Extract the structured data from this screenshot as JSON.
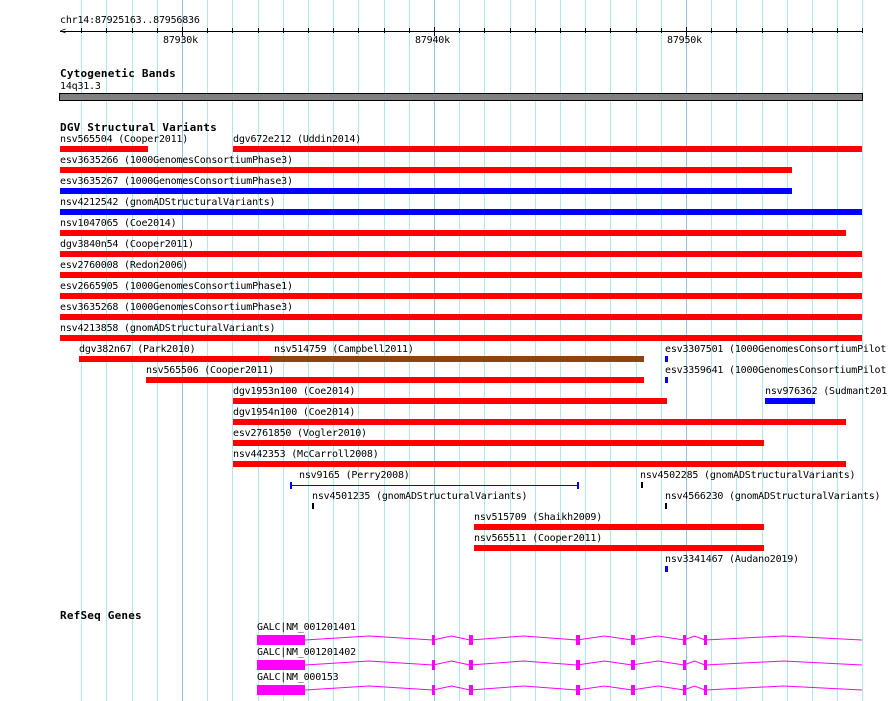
{
  "ruler": {
    "location": "chr14:87925163..87956836",
    "ticks": [
      "87930k",
      "87940k",
      "87950k"
    ]
  },
  "cytobands": {
    "title": "Cytogenetic Bands",
    "band": "14q31.3",
    "color": "#808080"
  },
  "dgv": {
    "title": "DGV Structural Variants",
    "colors": {
      "loss": "#ff0000",
      "gain": "#0000ff",
      "gain_loss": "#8b4513",
      "point": "#000000"
    },
    "features": [
      {
        "label": "nsv565504 (Cooper2011)",
        "type": "loss"
      },
      {
        "label": "dgv672e212 (Uddin2014)",
        "type": "loss"
      },
      {
        "label": "esv3635266 (1000GenomesConsortiumPhase3)",
        "type": "loss"
      },
      {
        "label": "esv3635267 (1000GenomesConsortiumPhase3)",
        "type": "gain"
      },
      {
        "label": "nsv4212542 (gnomADStructuralVariants)",
        "type": "gain"
      },
      {
        "label": "nsv1047065 (Coe2014)",
        "type": "loss"
      },
      {
        "label": "dgv3840n54 (Cooper2011)",
        "type": "loss"
      },
      {
        "label": "esv2760008 (Redon2006)",
        "type": "loss"
      },
      {
        "label": "esv2665905 (1000GenomesConsortiumPhase1)",
        "type": "loss"
      },
      {
        "label": "esv3635268 (1000GenomesConsortiumPhase3)",
        "type": "loss"
      },
      {
        "label": "nsv4213858 (gnomADStructuralVariants)",
        "type": "loss"
      },
      {
        "label": "dgv382n67 (Park2010)",
        "type": "loss"
      },
      {
        "label": "nsv514759 (Campbell2011)",
        "type": "gain_loss"
      },
      {
        "label": "esv3307501 (1000GenomesConsortiumPilot",
        "type": "gain"
      },
      {
        "label": "nsv565506 (Cooper2011)",
        "type": "loss"
      },
      {
        "label": "esv3359641 (1000GenomesConsortiumPilot",
        "type": "gain"
      },
      {
        "label": "dgv1953n100 (Coe2014)",
        "type": "loss"
      },
      {
        "label": "nsv976362 (Sudmant201",
        "type": "gain"
      },
      {
        "label": "dgv1954n100 (Coe2014)",
        "type": "loss"
      },
      {
        "label": "esv2761850 (Vogler2010)",
        "type": "loss"
      },
      {
        "label": "nsv442353 (McCarroll2008)",
        "type": "loss"
      },
      {
        "label": "nsv9165 (Perry2008)",
        "type": "gain_line"
      },
      {
        "label": "nsv4502285 (gnomADStructuralVariants)",
        "type": "point"
      },
      {
        "label": "nsv4501235 (gnomADStructuralVariants)",
        "type": "point"
      },
      {
        "label": "nsv4566230 (gnomADStructuralVariants)",
        "type": "point"
      },
      {
        "label": "nsv515709 (Shaikh2009)",
        "type": "loss"
      },
      {
        "label": "nsv565511 (Cooper2011)",
        "type": "loss"
      },
      {
        "label": "nsv3341467 (Audano2019)",
        "type": "gain"
      }
    ]
  },
  "refseq": {
    "title": "RefSeq Genes",
    "color": "#ff00ff",
    "genes": [
      {
        "label": "GALC|NM_001201401"
      },
      {
        "label": "GALC|NM_001201402"
      },
      {
        "label": "GALC|NM_000153"
      }
    ]
  }
}
